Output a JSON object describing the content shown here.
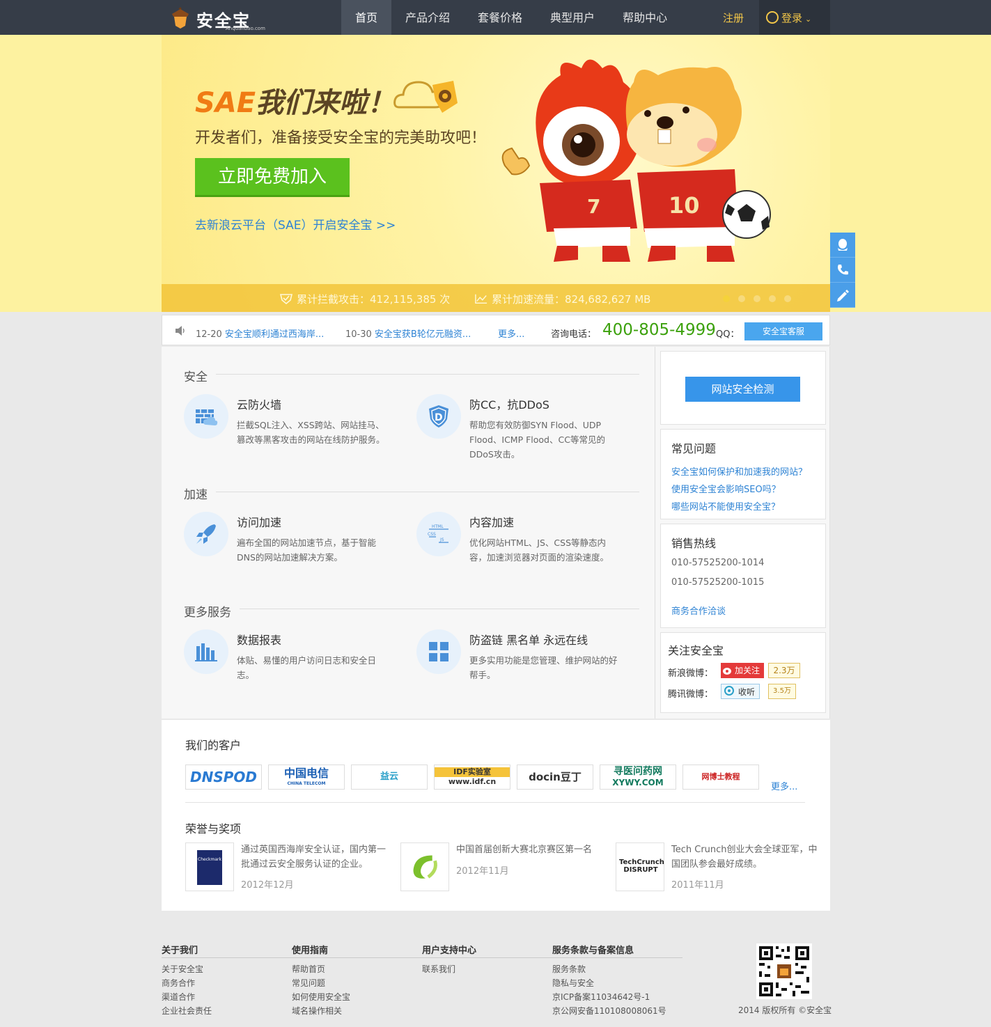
{
  "brand": {
    "name": "安全宝",
    "sub": "Anquanbao.com"
  },
  "nav": {
    "items": [
      "首页",
      "产品介绍",
      "套餐价格",
      "典型用户",
      "帮助中心"
    ],
    "register": "注册",
    "login": "登录"
  },
  "hero": {
    "title_sae": "SAE",
    "title_rest": "我们来啦！",
    "subtitle": "开发者们，准备接受安全宝的完美助攻吧！",
    "cta": "立即免费加入",
    "link": "去新浪云平台（SAE）开启安全宝 >>",
    "stat1": "累计拦截攻击：412,115,385 次",
    "stat2": "累计加速流量：824,682,627 MB",
    "jersey1": "7",
    "jersey2": "10"
  },
  "news": {
    "n1_date": "12-20",
    "n1_title": "安全宝顺利通过西海岸...",
    "n2_date": "10-30",
    "n2_title": "安全宝获B轮亿元融资...",
    "more": "更多...",
    "tel_label": "咨询电话：",
    "tel": "400-805-4999",
    "qq_label": "QQ：",
    "qq_btn": "安全宝客服"
  },
  "sections": {
    "security": "安全",
    "speed": "加速",
    "more": "更多服务"
  },
  "features": {
    "f1": {
      "title": "云防火墙",
      "desc": "拦截SQL注入、XSS跨站、网站挂马、篡改等黑客攻击的网站在线防护服务。"
    },
    "f2": {
      "title": "防CC，抗DDoS",
      "desc": "帮助您有效防御SYN Flood、UDP Flood、ICMP Flood、CC等常见的DDoS攻击。"
    },
    "f3": {
      "title": "访问加速",
      "desc": "遍布全国的网站加速节点，基于智能DNS的网站加速解决方案。"
    },
    "f4": {
      "title": "内容加速",
      "desc": "优化网站HTML、JS、CSS等静态内容，加速浏览器对页面的渲染速度。"
    },
    "f5": {
      "title": "数据报表",
      "desc": "体贴、易懂的用户访问日志和安全日志。"
    },
    "f6": {
      "title": "防盗链 黑名单 永远在线",
      "desc": "更多实用功能是您管理、维护网站的好帮手。"
    }
  },
  "sidebar": {
    "check_btn": "网站安全检测",
    "faq_title": "常见问题",
    "faq": [
      "安全宝如何保护和加速我的网站？",
      "使用安全宝会影响SEO吗？",
      "哪些网站不能使用安全宝？"
    ],
    "sales_title": "销售热线",
    "phones": [
      "010-57525200-1014",
      "010-57525200-1015"
    ],
    "biz_link": "商务合作洽谈",
    "follow_title": "关注安全宝",
    "sina_label": "新浪微博：",
    "sina_btn": "加关注",
    "sina_count": "2.3万",
    "qq_label": "腾讯微博：",
    "qq_btn": "收听",
    "qq_count": "3.5万"
  },
  "customers": {
    "title": "我们的客户",
    "logos": [
      "DNSPOD",
      "中国电信",
      "益云",
      "IDF实验室",
      "docin豆丁",
      "寻医问药网",
      "网博士教程"
    ],
    "logos_sub": [
      "",
      "CHINA TELECOM",
      "",
      "www.idf.cn",
      "",
      "XYWY.COM",
      ""
    ],
    "more": "更多..."
  },
  "awards": {
    "title": "荣誉与奖项",
    "items": [
      {
        "text": "通过英国西海岸安全认证，国内第一批通过云安全服务认证的企业。",
        "date": "2012年12月",
        "thumb": "Checkmark"
      },
      {
        "text": "中国首届创新大赛北京赛区第一名",
        "date": "2012年11月",
        "thumb": ""
      },
      {
        "text": "Tech Crunch创业大会全球亚军，中国团队参会最好成绩。",
        "date": "2011年11月",
        "thumb": "TechCrunch DISRUPT"
      }
    ]
  },
  "footer": {
    "cols": [
      {
        "title": "关于我们",
        "links": [
          "关于安全宝",
          "商务合作",
          "渠道合作",
          "企业社会责任"
        ]
      },
      {
        "title": "使用指南",
        "links": [
          "帮助首页",
          "常见问题",
          "如何使用安全宝",
          "域名操作相关"
        ]
      },
      {
        "title": "用户支持中心",
        "links": [
          "联系我们"
        ]
      },
      {
        "title": "服务条款与备案信息",
        "links": [
          "服务条款",
          "隐私与安全",
          "京ICP备案11034642号-1",
          "京公网安备110108008061号"
        ]
      }
    ],
    "copyright": "2014 版权所有 ©安全宝"
  },
  "colors": {
    "nav_bg": "#363d48",
    "accent_yellow": "#f2c648",
    "cta_green": "#5bc11e",
    "link_blue": "#2e83d4",
    "hero_bg": "#fdf2a0"
  }
}
